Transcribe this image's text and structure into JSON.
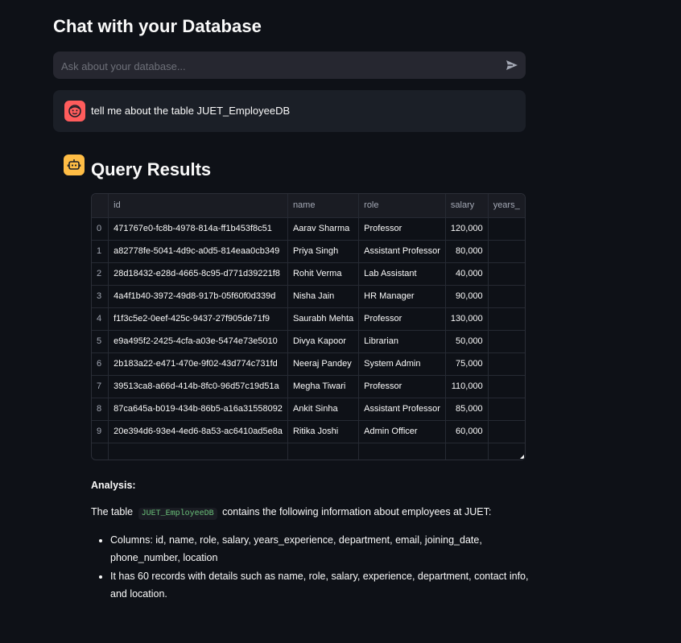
{
  "page": {
    "title": "Chat with your Database"
  },
  "chat_input": {
    "placeholder": "Ask about your database..."
  },
  "user_message": {
    "text": "tell me about the table JUET_EmployeeDB"
  },
  "assistant": {
    "results_title": "Query Results",
    "table": {
      "columns": [
        "id",
        "name",
        "role",
        "salary",
        "years_"
      ],
      "rows": [
        {
          "index": "0",
          "id": "471767e0-fc8b-4978-814a-ff1b453f8c51",
          "name": "Aarav Sharma",
          "role": "Professor",
          "salary": "120,000"
        },
        {
          "index": "1",
          "id": "a82778fe-5041-4d9c-a0d5-814eaa0cb349",
          "name": "Priya Singh",
          "role": "Assistant Professor",
          "salary": "80,000"
        },
        {
          "index": "2",
          "id": "28d18432-e28d-4665-8c95-d771d39221f8",
          "name": "Rohit Verma",
          "role": "Lab Assistant",
          "salary": "40,000"
        },
        {
          "index": "3",
          "id": "4a4f1b40-3972-49d8-917b-05f60f0d339d",
          "name": "Nisha Jain",
          "role": "HR Manager",
          "salary": "90,000"
        },
        {
          "index": "4",
          "id": "f1f3c5e2-0eef-425c-9437-27f905de71f9",
          "name": "Saurabh Mehta",
          "role": "Professor",
          "salary": "130,000"
        },
        {
          "index": "5",
          "id": "e9a495f2-2425-4cfa-a03e-5474e73e5010",
          "name": "Divya Kapoor",
          "role": "Librarian",
          "salary": "50,000"
        },
        {
          "index": "6",
          "id": "2b183a22-e471-470e-9f02-43d774c731fd",
          "name": "Neeraj Pandey",
          "role": "System Admin",
          "salary": "75,000"
        },
        {
          "index": "7",
          "id": "39513ca8-a66d-414b-8fc0-96d57c19d51a",
          "name": "Megha Tiwari",
          "role": "Professor",
          "salary": "110,000"
        },
        {
          "index": "8",
          "id": "87ca645a-b019-434b-86b5-a16a31558092",
          "name": "Ankit Sinha",
          "role": "Assistant Professor",
          "salary": "85,000"
        },
        {
          "index": "9",
          "id": "20e394d6-93e4-4ed6-8a53-ac6410ad5e8a",
          "name": "Ritika Joshi",
          "role": "Admin Officer",
          "salary": "60,000"
        }
      ]
    },
    "analysis": {
      "heading": "Analysis:",
      "intro_prefix": "The table",
      "table_name": "JUET_EmployeeDB",
      "intro_suffix": "contains the following information about employees at JUET:",
      "bullets": [
        "Columns: id, name, role, salary, years_experience, department, email, joining_date, phone_number, location",
        "It has 60 records with details such as name, role, salary, experience, department, contact info, and location."
      ]
    }
  },
  "colors": {
    "background": "#0e1117",
    "input_bg": "#262730",
    "user_avatar": "#ff5c5c",
    "bot_avatar": "#ffbd45",
    "code_text": "#6bc27a"
  },
  "icons": {
    "send": "send-icon",
    "user_avatar": "user-face-icon",
    "bot_avatar": "robot-icon"
  }
}
